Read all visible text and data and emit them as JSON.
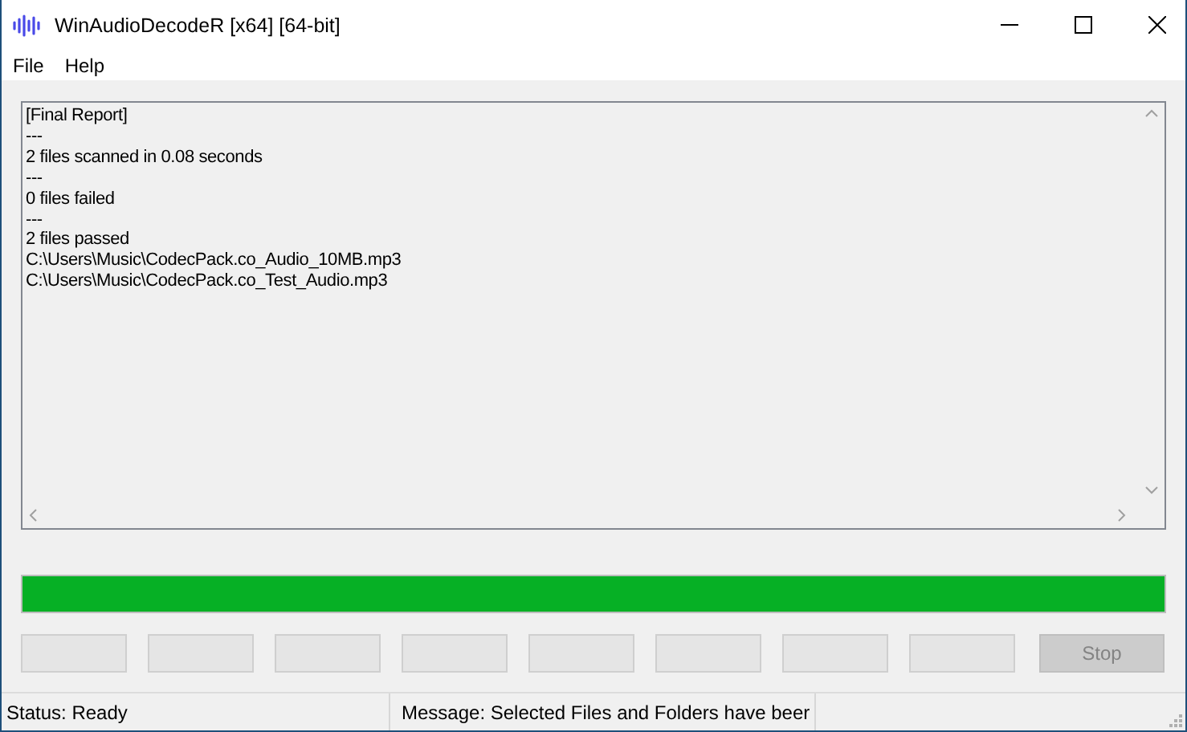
{
  "window": {
    "title": "WinAudioDecodeR [x64] [64-bit]"
  },
  "menu": [
    {
      "label": "File"
    },
    {
      "label": "Help"
    }
  ],
  "log": {
    "lines": [
      "[Final Report]",
      "---",
      "2 files scanned in 0.08 seconds",
      "---",
      "0 files failed",
      "---",
      "2 files passed",
      "C:\\Users\\Music\\CodecPack.co_Audio_10MB.mp3",
      "C:\\Users\\Music\\CodecPack.co_Test_Audio.mp3"
    ]
  },
  "progress": {
    "level": 1
  },
  "buttons": [
    {
      "kind": "blank",
      "disabled": false
    },
    {
      "kind": "blank",
      "disabled": false
    },
    {
      "kind": "blank",
      "disabled": false
    },
    {
      "kind": "blank",
      "disabled": false
    },
    {
      "kind": "blank",
      "disabled": false
    },
    {
      "kind": "blank",
      "disabled": false
    },
    {
      "kind": "blank",
      "disabled": false
    },
    {
      "kind": "blank",
      "disabled": false
    },
    {
      "kind": "text",
      "label": "Stop",
      "disabled": true
    }
  ],
  "status_bar": {
    "status": "Status: Ready",
    "message": "Message: Selected Files and Folders have beer"
  }
}
